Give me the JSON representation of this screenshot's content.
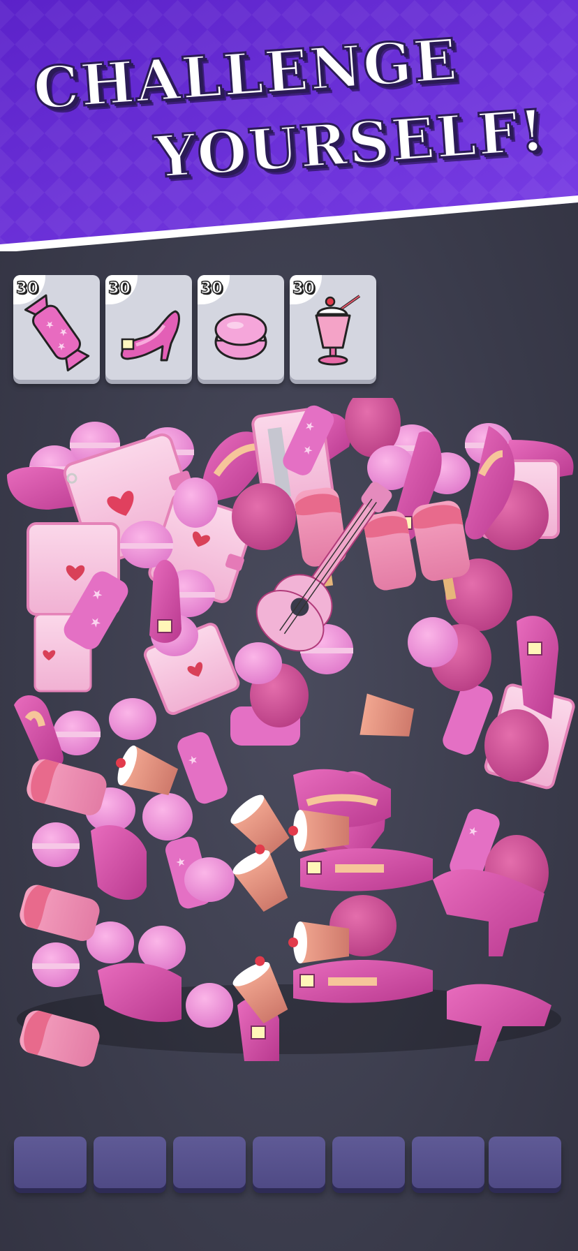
{
  "banner": {
    "line1": "CHALLENGE",
    "line2": "YOURSELF!"
  },
  "goals": [
    {
      "count": "30",
      "item": "candy"
    },
    {
      "count": "30",
      "item": "high-heel-shoe"
    },
    {
      "count": "30",
      "item": "macaron"
    },
    {
      "count": "30",
      "item": "milkshake"
    }
  ],
  "pile_items": [
    "macaron",
    "high-heel-shoe",
    "candy",
    "milkshake",
    "notebook",
    "balloon",
    "ice-cream-bar",
    "ukulele"
  ],
  "slots_count": 7,
  "colors": {
    "banner": "#6a2fd6",
    "background": "#3a3b4b",
    "item_pink": "#f08ccf",
    "item_magenta": "#d84ea8",
    "slot": "#5a5590",
    "card": "#d4d6e0"
  }
}
